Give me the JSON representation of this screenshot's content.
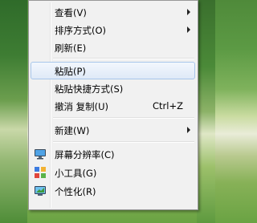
{
  "menu": {
    "items": [
      {
        "label": "查看(V)",
        "submenu": true
      },
      {
        "label": "排序方式(O)",
        "submenu": true
      },
      {
        "label": "刷新(E)"
      },
      {
        "label": "粘贴(P)",
        "highlighted": true
      },
      {
        "label": "粘贴快捷方式(S)"
      },
      {
        "label": "撤消 复制(U)",
        "shortcut": "Ctrl+Z"
      },
      {
        "label": "新建(W)",
        "submenu": true
      },
      {
        "label": "屏幕分辨率(C)",
        "icon": "monitor-icon"
      },
      {
        "label": "小工具(G)",
        "icon": "gadgets-icon"
      },
      {
        "label": "个性化(R)",
        "icon": "personalize-icon"
      }
    ]
  },
  "colors": {
    "menu_bg": "#f1f1f1",
    "highlight_border": "#a8c6ea",
    "wallpaper_green": "#5c9a44"
  }
}
